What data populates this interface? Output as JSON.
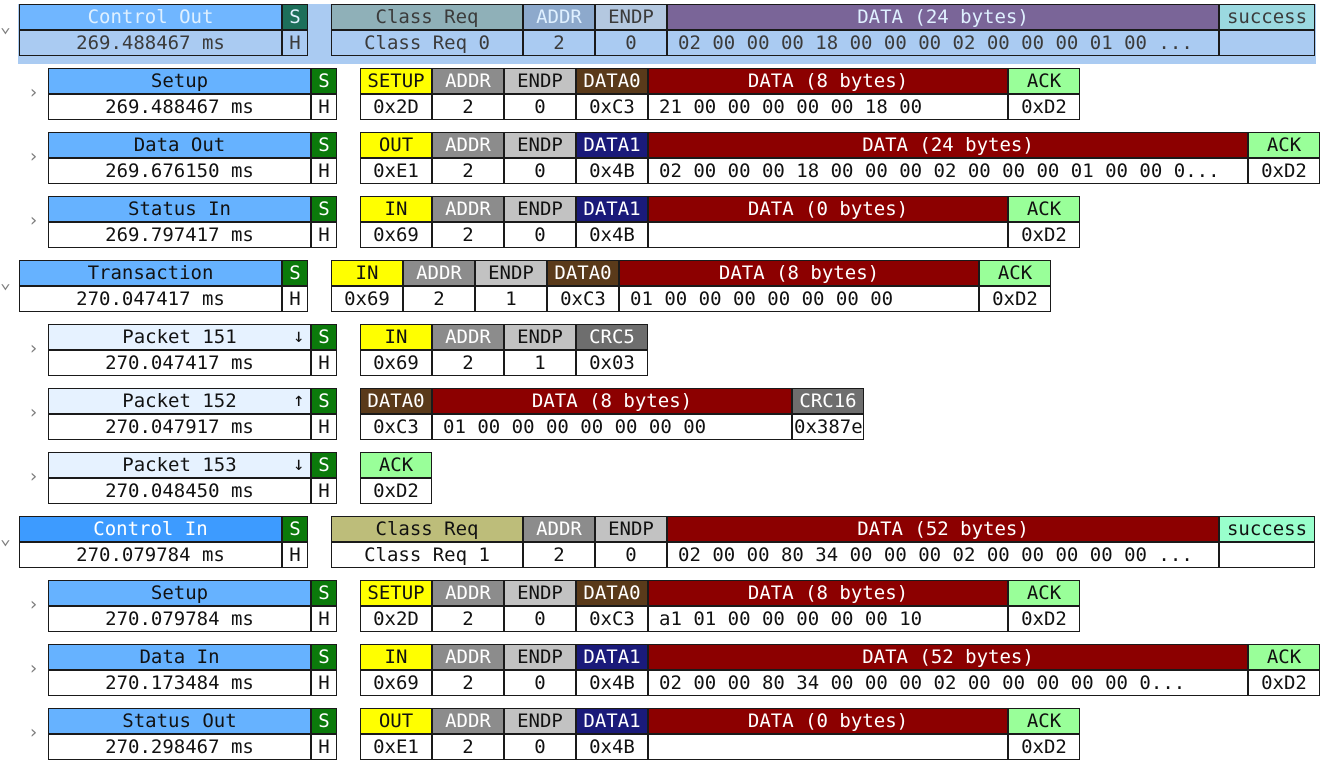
{
  "rows": [
    {
      "kind": "control",
      "selected": true,
      "name": "Control Out",
      "time": "269.488467 ms",
      "speed": "S",
      "hub": "H",
      "fields": [
        {
          "type": "creq",
          "label": "Class Req",
          "value": "Class Req 0"
        },
        {
          "type": "addr",
          "label": "ADDR",
          "value": "2"
        },
        {
          "type": "endp",
          "label": "ENDP",
          "value": "0"
        },
        {
          "type": "data",
          "label": "DATA (24 bytes)",
          "value": "02 00 00 00 18 00 00 00 02 00 00 00 01 00 ..."
        },
        {
          "type": "success",
          "label": "success",
          "value": ""
        }
      ]
    },
    {
      "kind": "stage",
      "name": "Setup",
      "time": "269.488467 ms",
      "speed": "S",
      "hub": "H",
      "fields": [
        {
          "type": "setup",
          "label": "SETUP",
          "value": "0x2D"
        },
        {
          "type": "addr",
          "label": "ADDR",
          "value": "2"
        },
        {
          "type": "endp",
          "label": "ENDP",
          "value": "0"
        },
        {
          "type": "data0",
          "label": "DATA0",
          "value": "0xC3"
        },
        {
          "type": "data",
          "label": "DATA (8 bytes)",
          "value": "21 00 00 00 00 00 18 00"
        },
        {
          "type": "ack",
          "label": "ACK",
          "value": "0xD2"
        }
      ]
    },
    {
      "kind": "stage",
      "name": "Data Out",
      "time": "269.676150 ms",
      "speed": "S",
      "hub": "H",
      "fields": [
        {
          "type": "out",
          "label": "OUT",
          "value": "0xE1"
        },
        {
          "type": "addr",
          "label": "ADDR",
          "value": "2"
        },
        {
          "type": "endp",
          "label": "ENDP",
          "value": "0"
        },
        {
          "type": "data1",
          "label": "DATA1",
          "value": "0x4B"
        },
        {
          "type": "data",
          "label": "DATA (24 bytes)",
          "value": "02 00 00 00 18 00 00 00 02 00 00 00 01 00 00 0..."
        },
        {
          "type": "ack",
          "label": "ACK",
          "value": "0xD2"
        }
      ]
    },
    {
      "kind": "stage",
      "name": "Status In",
      "time": "269.797417 ms",
      "speed": "S",
      "hub": "H",
      "fields": [
        {
          "type": "in",
          "label": "IN",
          "value": "0x69"
        },
        {
          "type": "addr",
          "label": "ADDR",
          "value": "2"
        },
        {
          "type": "endp",
          "label": "ENDP",
          "value": "0"
        },
        {
          "type": "data1",
          "label": "DATA1",
          "value": "0x4B"
        },
        {
          "type": "data",
          "label": "DATA (0 bytes)",
          "value": ""
        },
        {
          "type": "ack",
          "label": "ACK",
          "value": "0xD2"
        }
      ]
    },
    {
      "kind": "transaction",
      "name": "Transaction",
      "time": "270.047417 ms",
      "speed": "S",
      "hub": "H",
      "fields": [
        {
          "type": "in",
          "label": "IN",
          "value": "0x69"
        },
        {
          "type": "addr",
          "label": "ADDR",
          "value": "2"
        },
        {
          "type": "endp",
          "label": "ENDP",
          "value": "1"
        },
        {
          "type": "data0",
          "label": "DATA0",
          "value": "0xC3"
        },
        {
          "type": "data",
          "label": "DATA (8 bytes)",
          "value": "01 00 00 00 00 00 00 00"
        },
        {
          "type": "ack",
          "label": "ACK",
          "value": "0xD2"
        }
      ]
    },
    {
      "kind": "packet",
      "name": "Packet 151",
      "arrow": "↓",
      "time": "270.047417 ms",
      "speed": "S",
      "hub": "H",
      "fields": [
        {
          "type": "in",
          "label": "IN",
          "value": "0x69"
        },
        {
          "type": "addr",
          "label": "ADDR",
          "value": "2"
        },
        {
          "type": "endp",
          "label": "ENDP",
          "value": "1"
        },
        {
          "type": "crc",
          "label": "CRC5",
          "value": "0x03"
        }
      ]
    },
    {
      "kind": "packet",
      "name": "Packet 152",
      "arrow": "↑",
      "time": "270.047917 ms",
      "speed": "S",
      "hub": "H",
      "fields": [
        {
          "type": "data0",
          "label": "DATA0",
          "value": "0xC3"
        },
        {
          "type": "data",
          "label": "DATA (8 bytes)",
          "value": "01 00 00 00 00 00 00 00"
        },
        {
          "type": "crc",
          "label": "CRC16",
          "value": "0x387e"
        }
      ]
    },
    {
      "kind": "packet",
      "name": "Packet 153",
      "arrow": "↓",
      "time": "270.048450 ms",
      "speed": "S",
      "hub": "H",
      "fields": [
        {
          "type": "ack",
          "label": "ACK",
          "value": "0xD2"
        }
      ]
    },
    {
      "kind": "control",
      "name": "Control In",
      "time": "270.079784 ms",
      "speed": "S",
      "hub": "H",
      "fields": [
        {
          "type": "creq",
          "label": "Class Req",
          "value": "Class Req 1"
        },
        {
          "type": "addr",
          "label": "ADDR",
          "value": "2"
        },
        {
          "type": "endp",
          "label": "ENDP",
          "value": "0"
        },
        {
          "type": "data",
          "label": "DATA (52 bytes)",
          "value": "02 00 00 80 34 00 00 00 02 00 00 00 00 00 ..."
        },
        {
          "type": "success",
          "label": "success",
          "value": ""
        }
      ]
    },
    {
      "kind": "stage",
      "name": "Setup",
      "time": "270.079784 ms",
      "speed": "S",
      "hub": "H",
      "fields": [
        {
          "type": "setup",
          "label": "SETUP",
          "value": "0x2D"
        },
        {
          "type": "addr",
          "label": "ADDR",
          "value": "2"
        },
        {
          "type": "endp",
          "label": "ENDP",
          "value": "0"
        },
        {
          "type": "data0",
          "label": "DATA0",
          "value": "0xC3"
        },
        {
          "type": "data",
          "label": "DATA (8 bytes)",
          "value": "a1 01 00 00 00 00 00 10"
        },
        {
          "type": "ack",
          "label": "ACK",
          "value": "0xD2"
        }
      ]
    },
    {
      "kind": "stage",
      "name": "Data In",
      "time": "270.173484 ms",
      "speed": "S",
      "hub": "H",
      "fields": [
        {
          "type": "in",
          "label": "IN",
          "value": "0x69"
        },
        {
          "type": "addr",
          "label": "ADDR",
          "value": "2"
        },
        {
          "type": "endp",
          "label": "ENDP",
          "value": "0"
        },
        {
          "type": "data1",
          "label": "DATA1",
          "value": "0x4B"
        },
        {
          "type": "data",
          "label": "DATA (52 bytes)",
          "value": "02 00 00 80 34 00 00 00 02 00 00 00 00 00 0..."
        },
        {
          "type": "ack",
          "label": "ACK",
          "value": "0xD2"
        }
      ]
    },
    {
      "kind": "stage",
      "name": "Status Out",
      "time": "270.298467 ms",
      "speed": "S",
      "hub": "H",
      "fields": [
        {
          "type": "out",
          "label": "OUT",
          "value": "0xE1"
        },
        {
          "type": "addr",
          "label": "ADDR",
          "value": "2"
        },
        {
          "type": "endp",
          "label": "ENDP",
          "value": "0"
        },
        {
          "type": "data1",
          "label": "DATA1",
          "value": "0x4B"
        },
        {
          "type": "data",
          "label": "DATA (0 bytes)",
          "value": ""
        },
        {
          "type": "ack",
          "label": "ACK",
          "value": "0xD2"
        }
      ]
    }
  ]
}
